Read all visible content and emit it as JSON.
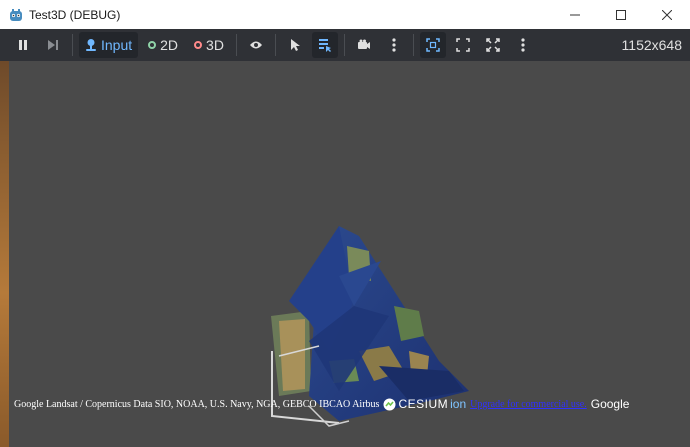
{
  "window": {
    "title": "Test3D (DEBUG)"
  },
  "toolbar": {
    "input_label": "Input",
    "mode_2d_label": "2D",
    "mode_3d_label": "3D",
    "resolution": "1152x648",
    "accent_color": "#70b8ff"
  },
  "viewport": {
    "attribution_text": "Google Landsat / Copernicus Data SIO, NOAA, U.S. Navy, NGA, GEBCO IBCAO Airbus",
    "cesium_label": "CESIUM",
    "ion_label": "ion",
    "upgrade_link": "Upgrade for commercial use.",
    "google_label": "Google"
  }
}
